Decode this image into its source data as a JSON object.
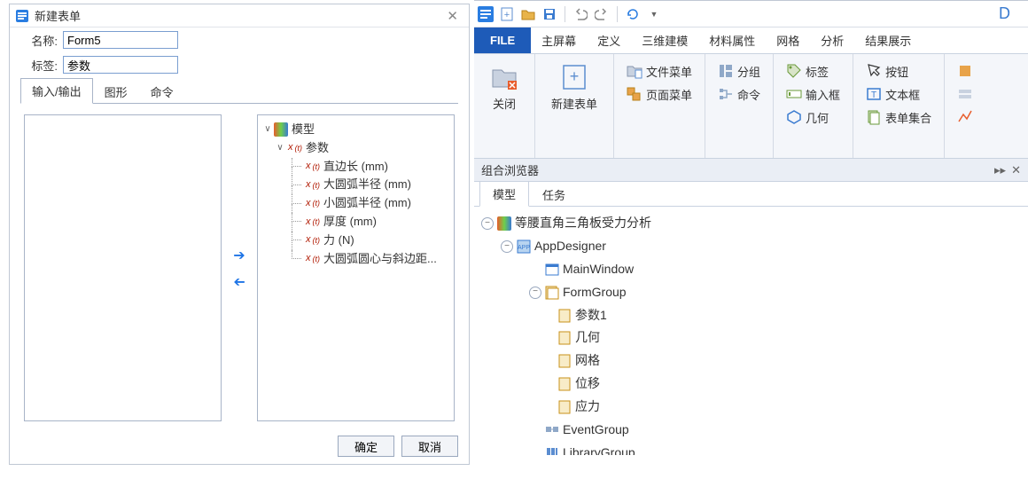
{
  "dialog": {
    "title": "新建表单",
    "name_label": "名称:",
    "name_value": "Form5",
    "tag_label": "标签:",
    "tag_value": "参数",
    "tabs": [
      "输入/输出",
      "图形",
      "命令"
    ],
    "tree_root": "模型",
    "tree_param": "参数",
    "items": [
      "直边长 (mm)",
      "大圆弧半径 (mm)",
      "小圆弧半径 (mm)",
      "厚度 (mm)",
      "力 (N)",
      "大圆弧圆心与斜边距..."
    ],
    "ok": "确定",
    "cancel": "取消"
  },
  "toolbar": {
    "right_letter": "D"
  },
  "menubar": {
    "file": "FILE",
    "items": [
      "主屏幕",
      "定义",
      "三维建模",
      "材料属性",
      "网格",
      "分析",
      "结果展示"
    ]
  },
  "ribbon": {
    "close": "关闭",
    "new_form": "新建表单",
    "file_menu": "文件菜单",
    "page_menu": "页面菜单",
    "group": "分组",
    "command": "命令",
    "label": "标签",
    "input": "输入框",
    "geometry": "几何",
    "button": "按钮",
    "textbox": "文本框",
    "form_set": "表单集合"
  },
  "browser": {
    "title": "组合浏览器",
    "tabs": [
      "模型",
      "任务"
    ],
    "root": "等腰直角三角板受力分析",
    "appdesigner": "AppDesigner",
    "mainwindow": "MainWindow",
    "formgroup": "FormGroup",
    "forms": [
      "参数1",
      "几何",
      "网格",
      "位移",
      "应力"
    ],
    "eventgroup": "EventGroup",
    "librarygroup": "LibraryGroup"
  },
  "colors": {
    "accent": "#1e5bb8"
  }
}
